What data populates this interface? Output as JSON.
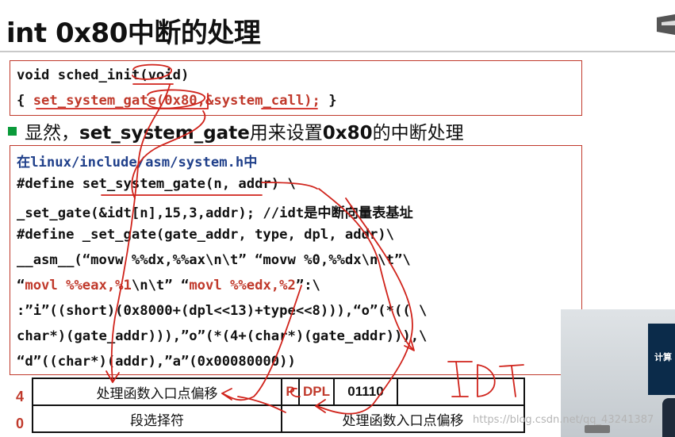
{
  "title": "int 0x80中断的处理",
  "code_box1": {
    "line1": "void sched_init(void)",
    "line2_prefix": "{ ",
    "line2_call": "set_system_gate(0x80,&system_call);",
    "line2_suffix": " }"
  },
  "bullet": {
    "prefix": "显然，",
    "bold1": "set_system_gate",
    "middle": "用来设置",
    "bold2": "0x80",
    "suffix": "的中断处理"
  },
  "code_box2": {
    "line1_a": "在",
    "line1_b": "linux/include/asm/system.h",
    "line1_c": "中",
    "line2": "#define set_system_gate(n, addr) \\",
    "line3": "_set_gate(&idt[n],15,3,addr); //idt是中断向量表基址",
    "line4": "#define _set_gate(gate_addr, type, dpl, addr)\\",
    "line5": "__asm__(“movw %%dx,%%ax\\n\\t” “movw %0,%%dx\\n\\t”\\",
    "line6_a": "“",
    "line6_b": "movl %%eax,%1",
    "line6_c": "\\n\\t” “",
    "line6_d": "movl %%edx,%2",
    "line6_e": "”:\\",
    "line7": ":”i”((short)(0x8000+(dpl<<13)+type<<8))),“o”(*(( \\",
    "line8": "char*)(gate_addr))),”o”(*(4+(char*)(gate_addr))),\\",
    "line9": "“d”((char*)(addr),”a”(0x00080000))"
  },
  "idt_table": {
    "row_label_top": "4",
    "row_label_bottom": "0",
    "top_left": "处理函数入口点偏移",
    "flag_p": "P",
    "flag_dpl": "DPL",
    "bits": "01110",
    "bottom_left": "段选择符",
    "bottom_right": "处理函数入口点偏移"
  },
  "handwritten_note": "IDT",
  "video_label": "计算",
  "watermark": "https://blog.csdn.net/qq_43241387",
  "colors": {
    "accent_red": "#c0392b",
    "bullet_green": "#0a9a3a",
    "path_blue": "#1f3f8a"
  },
  "icons": {
    "corner": "partial-logo-icon"
  }
}
